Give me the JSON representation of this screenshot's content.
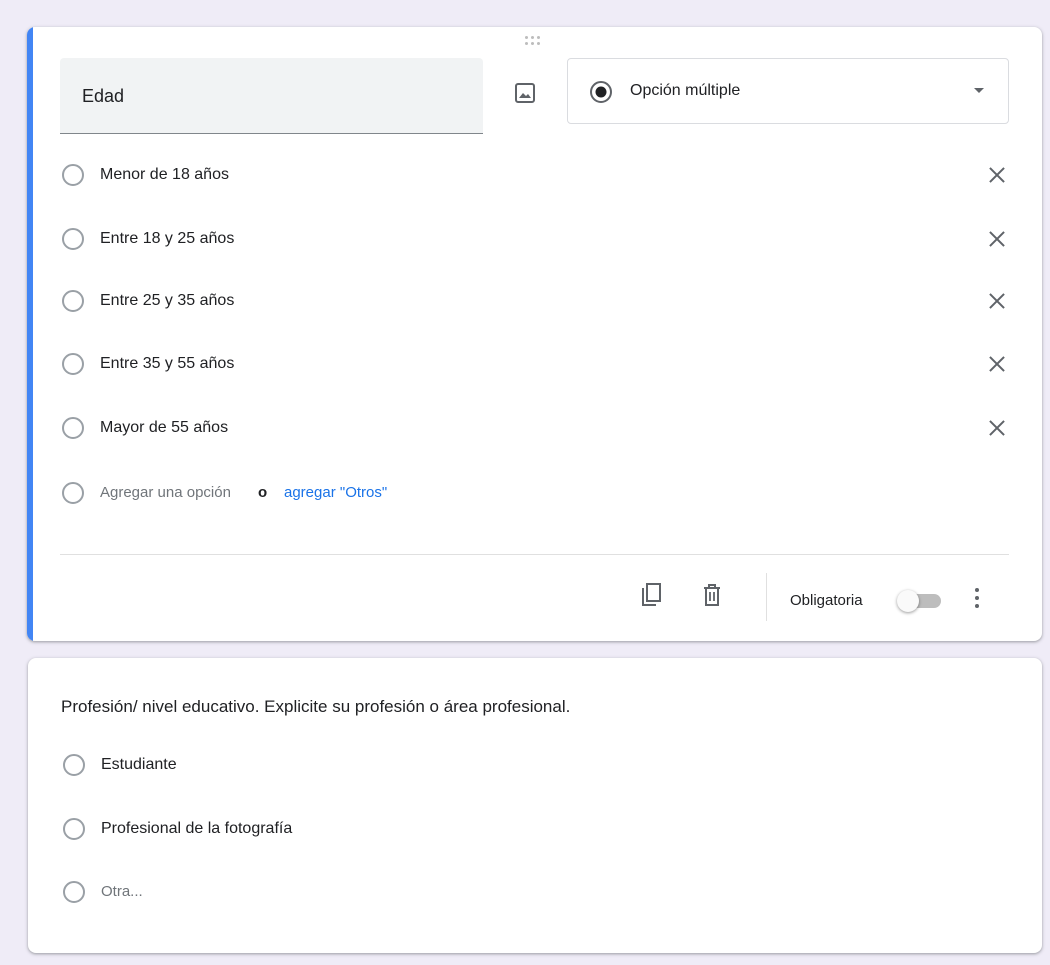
{
  "question1": {
    "title_value": "Edad",
    "type_select": {
      "selected": "Opción múltiple",
      "icon": "radio-checked-icon"
    },
    "options": [
      {
        "label": "Menor de 18 años"
      },
      {
        "label": "Entre 18 y 25 años"
      },
      {
        "label": "Entre 25 y 35 años"
      },
      {
        "label": "Entre 35 y 55 años"
      },
      {
        "label": "Mayor de 55 años"
      }
    ],
    "add_option_label": "Agregar una opción",
    "or_label": "o",
    "add_other_link": "agregar \"Otros\"",
    "footer": {
      "duplicate_icon": "copy-icon",
      "delete_icon": "trash-icon",
      "required_label": "Obligatoria",
      "required_enabled": false,
      "more_icon": "more-vert-icon"
    }
  },
  "question2": {
    "title": "Profesión/ nivel educativo. Explicite su profesión o área profesional.",
    "options": [
      {
        "label": "Estudiante"
      },
      {
        "label": "Profesional de la fotografía"
      }
    ],
    "other_label": "Otra..."
  },
  "colors": {
    "accent": "#4285f4",
    "link": "#1a73e8",
    "background": "#efecf7"
  }
}
